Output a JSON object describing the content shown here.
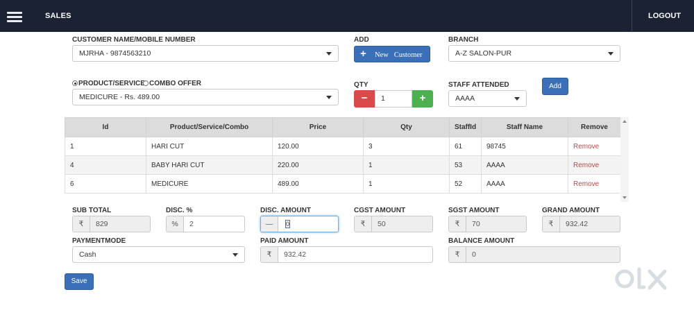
{
  "header": {
    "title": "SALES",
    "logout_label": "LOGOUT"
  },
  "customer": {
    "label": "CUSTOMER NAME/MOBILE NUMBER",
    "value": "MJRHA - 9874563210",
    "add_label": "ADD",
    "new_customer_label": "New   Customer"
  },
  "branch": {
    "label": "BRANCH",
    "value": "A-Z SALON-PUR"
  },
  "item_type": {
    "option_product": "PRODUCT/SERVICE",
    "option_combo": "COMBO OFFER",
    "selected": "PRODUCT/SERVICE"
  },
  "product": {
    "value": "MEDICURE - Rs. 489.00"
  },
  "qty": {
    "label": "QTY",
    "value": "1"
  },
  "staff": {
    "label": "STAFF ATTENDED",
    "value": "AAAA",
    "add_label": "Add"
  },
  "table": {
    "columns": [
      "Id",
      "Product/Service/Combo",
      "Price",
      "Qty",
      "StaffId",
      "Staff Name",
      "Remove"
    ],
    "rows": [
      {
        "id": "1",
        "product": "HARI CUT",
        "price": "120.00",
        "qty": "3",
        "staff_id": "61",
        "staff_name": "98745",
        "remove": "Remove"
      },
      {
        "id": "4",
        "product": "BABY HARI CUT",
        "price": "220.00",
        "qty": "1",
        "staff_id": "53",
        "staff_name": "AAAA",
        "remove": "Remove"
      },
      {
        "id": "6",
        "product": "MEDICURE",
        "price": "489.00",
        "qty": "1",
        "staff_id": "52",
        "staff_name": "AAAA",
        "remove": "Remove"
      }
    ]
  },
  "totals": {
    "sub_total_label": "SUB TOTAL",
    "sub_total": "829",
    "disc_pct_label": "DISC. %",
    "disc_pct": "2",
    "disc_amount_label": "DISC. AMOUNT",
    "disc_amount": "0",
    "cgst_label": "CGST AMOUNT",
    "cgst": "50",
    "sgst_label": "SGST AMOUNT",
    "sgst": "70",
    "grand_total_label": "GRAND AMOUNT",
    "grand_total": "932.42",
    "payment_mode_label": "PAYMENTMODE",
    "payment_mode": "Cash",
    "paid_amount_label": "PAID AMOUNT",
    "paid_amount": "932.42",
    "balance_label": "BALANCE AMOUNT",
    "balance": "0",
    "currency_symbol": "₹",
    "percent_symbol": "%",
    "minus_symbol": "—"
  },
  "save_label": "Save",
  "icons": {
    "menu": "hamburger-icon",
    "plus": "plus-icon",
    "minus": "minus-icon",
    "caret": "chevron-down-icon",
    "watermark": "olx-logo"
  },
  "colors": {
    "header_bg": "#1b2233",
    "primary": "#3b6fb7",
    "danger": "#d84b4a",
    "success": "#4caf50",
    "remove_link": "#b94a48"
  }
}
